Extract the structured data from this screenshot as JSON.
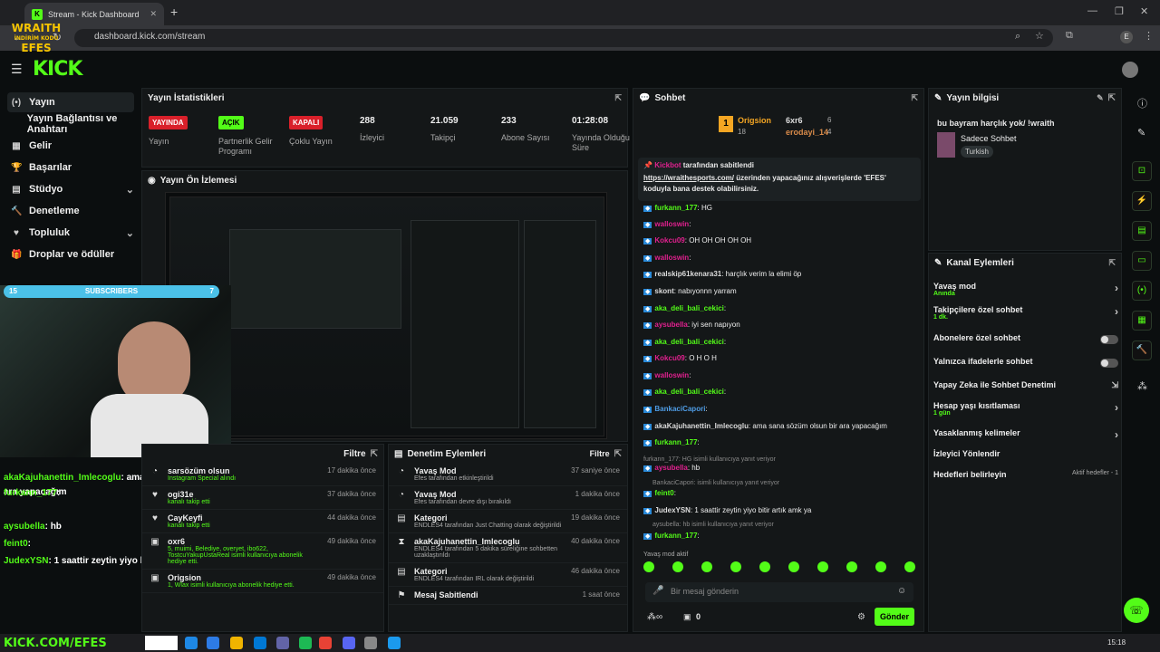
{
  "browser": {
    "tab_title": "Stream - Kick Dashboard",
    "url": "dashboard.kick.com/stream"
  },
  "overlay": {
    "brand_line1": "WRAITH",
    "brand_line2": "İNDİRİM KODU",
    "brand_line3": "EFES",
    "subscribers_label": "SUBSCRIBERS",
    "sub_left": "15",
    "sub_right": "7",
    "footer": "KICK.COM/EFES"
  },
  "kick": {
    "logo": "KICK"
  },
  "sidebar": {
    "items": [
      {
        "label": "Yayın",
        "icon": "(•)"
      },
      {
        "label": "Yayın Bağlantısı ve Anahtarı",
        "icon": ""
      },
      {
        "label": "Gelir",
        "icon": "▦"
      },
      {
        "label": "Başarılar",
        "icon": "🏆"
      },
      {
        "label": "Stüdyo",
        "icon": "▤"
      },
      {
        "label": "Denetleme",
        "icon": "🔨"
      },
      {
        "label": "Topluluk",
        "icon": "♥"
      },
      {
        "label": "Droplar ve ödüller",
        "icon": "🎁"
      }
    ]
  },
  "stats": {
    "title": "Yayın İstatistikleri",
    "cells": [
      {
        "badge": "YAYINDA",
        "label": "Yayın",
        "kind": "red"
      },
      {
        "badge": "AÇIK",
        "label": "Partnerlik Gelir Programı",
        "kind": "grn"
      },
      {
        "badge": "KAPALI",
        "label": "Çoklu Yayın",
        "kind": "red"
      },
      {
        "value": "288",
        "label": "İzleyici"
      },
      {
        "value": "21.059",
        "label": "Takipçi"
      },
      {
        "value": "233",
        "label": "Abone Sayısı"
      },
      {
        "value": "01:28:08",
        "label": "Yayında Olduğu Süre"
      }
    ]
  },
  "preview": {
    "title": "Yayın Ön İzlemesi"
  },
  "overlay_chat": [
    {
      "user": "akaKajuhanettin_Imlecoglu",
      "text": ": ama sana sözüm olsun bir ara yapacağım"
    },
    {
      "user": "furkann_177",
      "text": ":"
    },
    {
      "user": "aysubella",
      "text": ": hb"
    },
    {
      "user": "feint0",
      "text": ":"
    },
    {
      "user": "JudexYSN",
      "text": ": 1 saattir zeytin yiyo bitir artık amk ya"
    }
  ],
  "activity": {
    "filter": "Filtre",
    "items": [
      {
        "title": "sarsözüm olsun",
        "sub": "Instagram Special alındı",
        "time": "17 dakika önce"
      },
      {
        "title": "ogi31e",
        "sub": "kanalı takip etti",
        "time": "37 dakika önce"
      },
      {
        "title": "CayKeyfi",
        "sub": "kanalı takip etti",
        "time": "44 dakika önce"
      },
      {
        "title": "oxr6",
        "sub": "5, muimi, Belediye, overyet, ibo622, TostcuYakupUstaReal isimli kullanıcıya abonelik hediye etti.",
        "time": "49 dakika önce"
      },
      {
        "title": "Origsion",
        "sub": "1, Wlax isimli kullanıcıya abonelik hediye etti.",
        "time": "49 dakika önce"
      }
    ]
  },
  "moderation": {
    "title": "Denetim Eylemleri",
    "filter": "Filtre",
    "items": [
      {
        "title": "Yavaş Mod",
        "sub": "Efes tarafından etkinleştirildi",
        "time": "37 saniye önce"
      },
      {
        "title": "Yavaş Mod",
        "sub": "Efes tarafından devre dışı bırakıldı",
        "time": "1 dakika önce"
      },
      {
        "title": "Kategori",
        "sub": "ENDLES4 tarafından Just Chatting olarak değiştirildi",
        "time": "19 dakika önce"
      },
      {
        "title": "akaKajuhanettin_Imlecoglu",
        "sub": "ENDLES4 tarafından 5 dakika süreliğine sohbetten uzaklaştırıldı",
        "time": "40 dakika önce"
      },
      {
        "title": "Kategori",
        "sub": "ENDLES4 tarafından IRL olarak değiştirildi",
        "time": "46 dakika önce"
      },
      {
        "title": "Mesaj Sabitlendi",
        "sub": "",
        "time": "1 saat önce"
      }
    ]
  },
  "chat": {
    "title": "Sohbet",
    "top_gifter1": "Origsion",
    "top_gifter1_count": "18",
    "top_gifter2": "6xr6",
    "top_gifter2_count": "6",
    "top_gifter3": "erodayi_14",
    "top_gifter3_count": "4",
    "pinned_by": "Kickbot",
    "pinned_suffix": "tarafından sabitlendi",
    "pinned_link": "https://wraithesports.com/",
    "pinned_text": " üzerinden yapacağınız alışverişlerde 'EFES' koduyla bana destek olabilirsiniz.",
    "messages": [
      {
        "user": "furkann_177",
        "text": ": HG",
        "c": "gr"
      },
      {
        "user": "walloswin",
        "text": ":",
        "c": "pk"
      },
      {
        "user": "Kokcu09",
        "text": ": OH OH OH OH OH",
        "c": "pk"
      },
      {
        "user": "walloswin",
        "text": ":",
        "c": "pk"
      },
      {
        "user": "realskip61kenara31",
        "text": ": harçlık verim la elimi öp",
        "c": "yw"
      },
      {
        "user": "skont",
        "text": ": nabıyonnn yarram",
        "c": "yw"
      },
      {
        "user": "aka_deli_bali_cekici",
        "text": ":",
        "c": "gr"
      },
      {
        "user": "aysubella",
        "text": ": iyi sen napıyon",
        "c": "pk"
      },
      {
        "user": "aka_deli_bali_cekici",
        "text": ":",
        "c": "gr"
      },
      {
        "user": "Kokcu09",
        "text": ": O H O H",
        "c": "pk"
      },
      {
        "user": "walloswin",
        "text": ":",
        "c": "pk"
      },
      {
        "user": "aka_deli_bali_cekici",
        "text": ":",
        "c": "gr"
      },
      {
        "user": "BankaciCapori",
        "text": ":",
        "c": "bl"
      },
      {
        "user": "akaKajuhanettin_Imlecoglu",
        "text": ": ama sana sözüm olsun bir ara yapacağım",
        "c": "yw"
      },
      {
        "user": "furkann_177",
        "text": ":",
        "c": "gr"
      },
      {
        "user": "aysubella",
        "text": ": hb",
        "c": "pk"
      },
      {
        "user": "feint0",
        "text": ":",
        "c": "gr"
      },
      {
        "user": "JudexYSN",
        "text": ": 1 saattir zeytin yiyo bitir artık amk ya",
        "c": "yw"
      },
      {
        "user": "furkann_177",
        "text": ":",
        "c": "gr"
      }
    ],
    "reply1": "furkann_177: HG isimli kullanıcıya yanıt veriyor",
    "reply2": "BankaciCapori: isimli kullanıcıya yanıt veriyor",
    "reply3": "aysubella: hb isimli kullanıcıya yanıt veriyor",
    "slow_mode": "Yavaş mod aktif",
    "input_placeholder": "Bir mesaj gönderin",
    "count": "0",
    "send": "Gönder"
  },
  "stream_info": {
    "title": "Yayın bilgisi",
    "stream_title": "bu bayram harçlık yok/ !wraith",
    "category": "Sadece Sohbet",
    "tag": "Turkish"
  },
  "channel_actions": {
    "title": "Kanal Eylemleri",
    "items": [
      {
        "label": "Yavaş mod",
        "sub": "Anında",
        "ctl": "arrow"
      },
      {
        "label": "Takipçilere özel sohbet",
        "sub": "1 dk.",
        "ctl": "arrow"
      },
      {
        "label": "Abonelere özel sohbet",
        "sub": "",
        "ctl": "toggle"
      },
      {
        "label": "Yalnızca ifadelerle sohbet",
        "sub": "",
        "ctl": "toggle"
      },
      {
        "label": "Yapay Zeka ile Sohbet Denetimi",
        "sub": "",
        "ctl": "ext"
      },
      {
        "label": "Hesap yaşı kısıtlaması",
        "sub": "1 gün",
        "ctl": "arrow"
      },
      {
        "label": "Yasaklanmış kelimeler",
        "sub": "",
        "ctl": "arrow"
      },
      {
        "label": "İzleyici Yönlendir",
        "sub": "",
        "ctl": ""
      },
      {
        "label": "Hedefleri belirleyin",
        "sub": "",
        "ctl": "goal"
      }
    ],
    "goal_text": "Aktif hedefler - 1"
  },
  "taskbar": {
    "time": "15:18"
  }
}
